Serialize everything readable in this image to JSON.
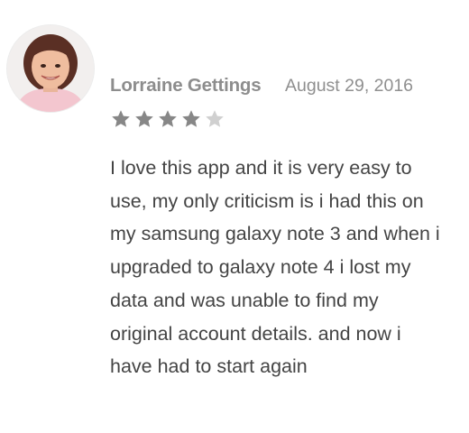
{
  "review": {
    "reviewer_name": "Lorraine Gettings",
    "date": "August 29, 2016",
    "rating": {
      "filled": 4,
      "total": 5
    },
    "text": "I love this app and it is very easy to\nuse, my only criticism is i had this on\nmy samsung galaxy note 3 and when i\nupgraded to galaxy note 4 i lost my\ndata and was unable to find my\noriginal account details. and now i\nhave had to start again"
  },
  "icons": {
    "avatar": "reviewer-avatar",
    "star_filled": "star-filled-icon",
    "star_empty": "star-empty-icon"
  },
  "colors": {
    "star_filled": "#878787",
    "star_empty": "#d0d0d0",
    "name": "#8d8d8d",
    "text": "#444444"
  }
}
